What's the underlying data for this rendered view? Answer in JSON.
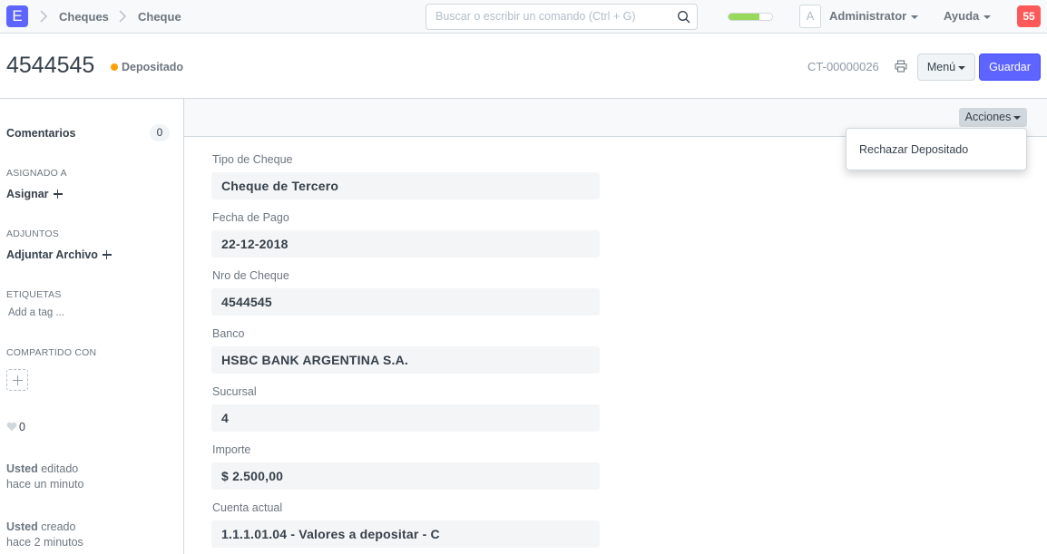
{
  "navbar": {
    "logo_letter": "E",
    "breadcrumbs": [
      "Cheques",
      "Cheque"
    ],
    "search_placeholder": "Buscar o escribir un comando (Ctrl + G)",
    "progress_fraction": 0.7,
    "avatar_letter": "A",
    "user_label": "Administrator",
    "help_label": "Ayuda",
    "notifications_count": "55"
  },
  "page_head": {
    "title": "4544545",
    "status": "Depositado",
    "doc_name": "CT-00000026",
    "menu_label": "Menú",
    "save_label": "Guardar"
  },
  "sidebar": {
    "comments_label": "Comentarios",
    "comments_count": "0",
    "assigned_heading": "ASIGNADO A",
    "assign_label": "Asignar",
    "attachments_heading": "ADJUNTOS",
    "attach_label": "Adjuntar Archivo",
    "tags_heading": "ETIQUETAS",
    "tag_placeholder": "Add a tag ...",
    "shared_heading": "COMPARTIDO CON",
    "likes_count": "0",
    "timeline": [
      {
        "user": "Usted",
        "action": "editado",
        "when": "hace un minuto"
      },
      {
        "user": "Usted",
        "action": "creado",
        "when": "hace 2 minutos"
      }
    ]
  },
  "form": {
    "actions_label": "Acciones",
    "actions_menu": [
      "Rechazar Depositado"
    ],
    "fields": [
      {
        "label": "Tipo de Cheque",
        "value": "Cheque de Tercero"
      },
      {
        "label": "Fecha de Pago",
        "value": "22-12-2018"
      },
      {
        "label": "Nro de Cheque",
        "value": "4544545"
      },
      {
        "label": "Banco",
        "value": "HSBC BANK ARGENTINA S.A."
      },
      {
        "label": "Sucursal",
        "value": "4"
      },
      {
        "label": "Importe",
        "value": "$ 2.500,00"
      },
      {
        "label": "Cuenta actual",
        "value": "1.1.1.01.04 - Valores a depositar - C"
      }
    ]
  },
  "colors": {
    "brand": "#5e64ff",
    "status_dot": "#ffa00a",
    "notification": "#ff5858",
    "progress": "#98d85b"
  }
}
